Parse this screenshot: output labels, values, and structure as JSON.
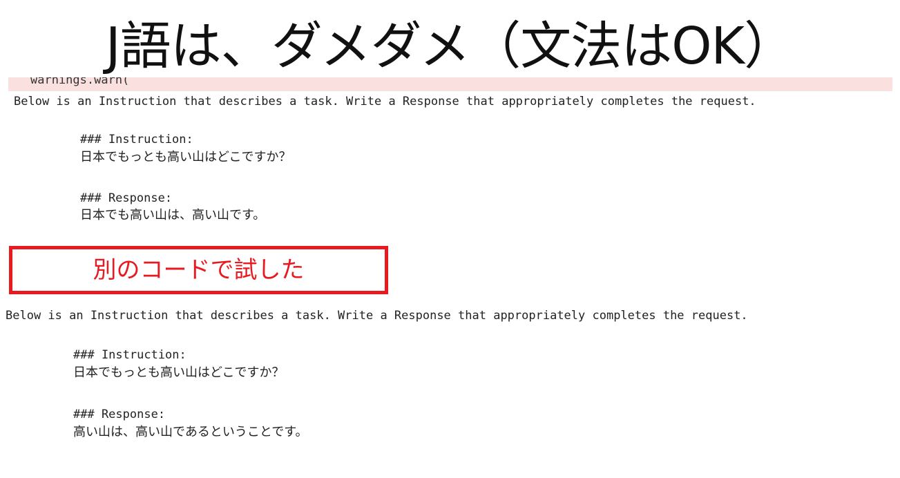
{
  "title": "J語は、ダメダメ（文法はOK）",
  "warning_line": "warnings.warn(",
  "note": "別のコードで試した",
  "output1": {
    "preamble": "Below is an Instruction that describes a task. Write a Response that appropriately completes the request.",
    "instruction_header": "### Instruction:",
    "instruction_text": "日本でもっとも高い山はどこですか？",
    "response_header": "### Response:",
    "response_text": "日本でも高い山は、高い山です。"
  },
  "output2": {
    "preamble": "Below is an Instruction that describes a task. Write a Response that appropriately completes the request.",
    "instruction_header": "### Instruction:",
    "instruction_text": "日本でもっとも高い山はどこですか？",
    "response_header": "### Response:",
    "response_text": "高い山は、高い山であるということです。"
  },
  "colors": {
    "note_red": "#e8191f",
    "warning_bg": "#fbe0e0"
  }
}
